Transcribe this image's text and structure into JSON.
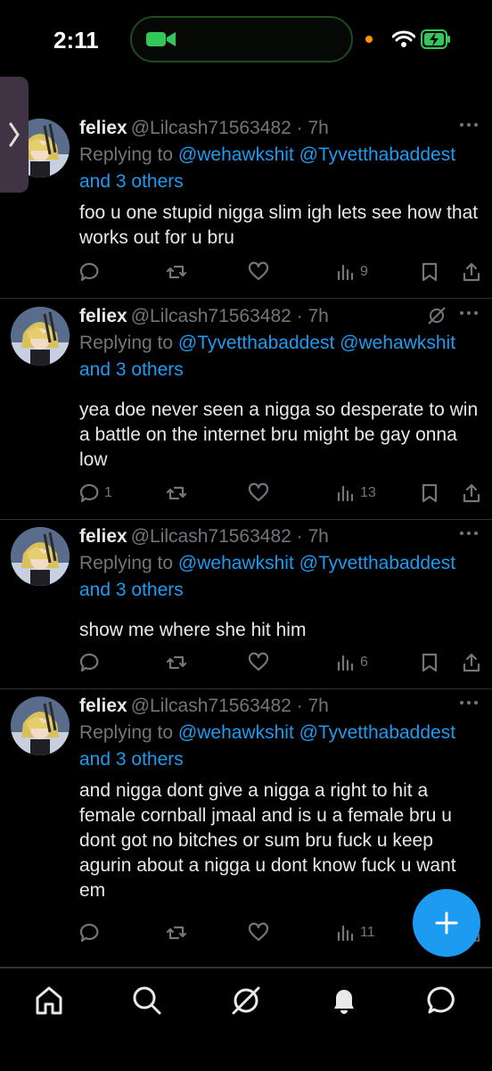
{
  "status_bar": {
    "time": "2:11"
  },
  "tweets": [
    {
      "name": "feliex",
      "handle": "@Lilcash71563482 · 7h",
      "reply_prefix": "Replying to",
      "mentions": [
        "@wehawkshit",
        "@Tyvetthabaddest"
      ],
      "others": "and 3 others",
      "text": "foo u one stupid nigga slim igh lets see how that works out for u bru",
      "replies": "",
      "views": "9"
    },
    {
      "name": "feliex",
      "handle": "@Lilcash71563482 · 7h",
      "reply_prefix": "Replying to",
      "mentions": [
        "@Tyvetthabaddest",
        "@wehawkshit"
      ],
      "others": "and 3 others",
      "text": "yea doe never seen a nigga so desperate to win a battle on the internet bru might be gay onna low",
      "replies": "1",
      "views": "13"
    },
    {
      "name": "feliex",
      "handle": "@Lilcash71563482 · 7h",
      "reply_prefix": "Replying to",
      "mentions": [
        "@wehawkshit",
        "@Tyvetthabaddest"
      ],
      "others": "and 3 others",
      "text": "show me where she hit him",
      "replies": "",
      "views": "6"
    },
    {
      "name": "feliex",
      "handle": "@Lilcash71563482 · 7h",
      "reply_prefix": "Replying to",
      "mentions": [
        "@wehawkshit",
        "@Tyvetthabaddest"
      ],
      "others": "and 3 others",
      "text": "and nigga dont give a nigga a right to hit a female cornball jmaal and is u a female bru u dont got no bitches or sum bru fuck u keep agurin about a nigga u dont know fuck u want em",
      "replies": "",
      "views": "11"
    }
  ],
  "icons": {
    "reply": "reply-icon",
    "retweet": "retweet-icon",
    "like": "like-icon",
    "views": "views-icon",
    "bookmark": "bookmark-icon",
    "share": "share-icon"
  },
  "colors": {
    "accent": "#1d9bf0",
    "muted": "#71767b",
    "text": "#e7e9ea"
  }
}
